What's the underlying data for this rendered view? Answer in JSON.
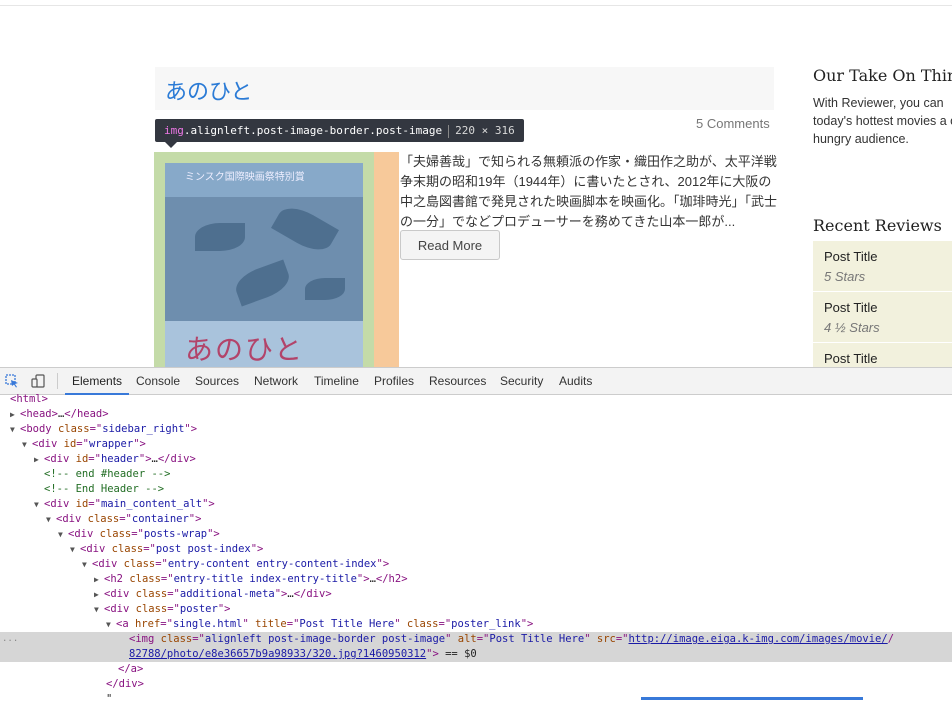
{
  "post": {
    "title": "あのひと",
    "comments": "5 Comments",
    "excerpt": "「夫婦善哉」で知られる無頼派の作家・織田作之助が、太平洋戦争末期の昭和19年（1944年）に書いたとされ、2012年に大阪の中之島図書館で発見された映画脚本を映画化。「珈琲時光」「武士の一分」でなどプロデューサーを務めてきた山本一郎が...",
    "read_more": "Read More",
    "poster_band_text": "ミンスク国際映画祭特別賞",
    "poster_script": "あのひと"
  },
  "inspector_tooltip": {
    "tag": "img",
    "classes": ".alignleft.post-image-border.post-image",
    "size": "220 × 316"
  },
  "sidebar": {
    "about_heading": "Our Take On Thing",
    "about_text": "With Reviewer, you can today's hottest movies a of a hungry audience.",
    "recent_heading": "Recent Reviews",
    "reviews": [
      {
        "title": "Post Title",
        "stars": "5 Stars"
      },
      {
        "title": "Post Title",
        "stars": "4 ½ Stars"
      },
      {
        "title": "Post Title",
        "stars": ""
      }
    ]
  },
  "devtools": {
    "tabs": [
      "Elements",
      "Console",
      "Sources",
      "Network",
      "Timeline",
      "Profiles",
      "Resources",
      "Security",
      "Audits"
    ],
    "active_tab": "Elements",
    "icons": [
      "inspect-element-icon",
      "device-mode-icon"
    ]
  },
  "dom": {
    "html": "html",
    "head": "head",
    "body": "body",
    "body_class": "sidebar_right",
    "div": "div",
    "id_attr": "id",
    "class_attr": "class",
    "wrapper": "wrapper",
    "header": "header",
    "comment_end_header": "<!-- end #header -->",
    "comment_End_Header": "<!-- End Header -->",
    "main_content_alt": "main_content_alt",
    "container": "container",
    "posts_wrap": "posts-wrap",
    "post_index": "post post-index",
    "entry_content": "entry-content entry-content-index",
    "h2": "h2",
    "entry_title": "entry-title index-entry-title",
    "additional_meta": "additional-meta",
    "poster": "poster",
    "a": "a",
    "href_attr": "href",
    "href_val": "single.html",
    "title_attr": "title",
    "title_val": "Post Title Here",
    "poster_link": "poster_link",
    "img": "img",
    "img_class": "alignleft post-image-border post-image",
    "alt_attr": "alt",
    "alt_val": "Post Title Here",
    "src_attr": "src",
    "src_line1": "http://image.eiga.k-img.com/images/movie/",
    "src_line2": "82788/photo/e8e36657b9a98933/320.jpg?1460950312",
    "eq_suffix": " == $0",
    "ellipsis": "…",
    "gutter": "...",
    "trailing_quote": "\""
  }
}
